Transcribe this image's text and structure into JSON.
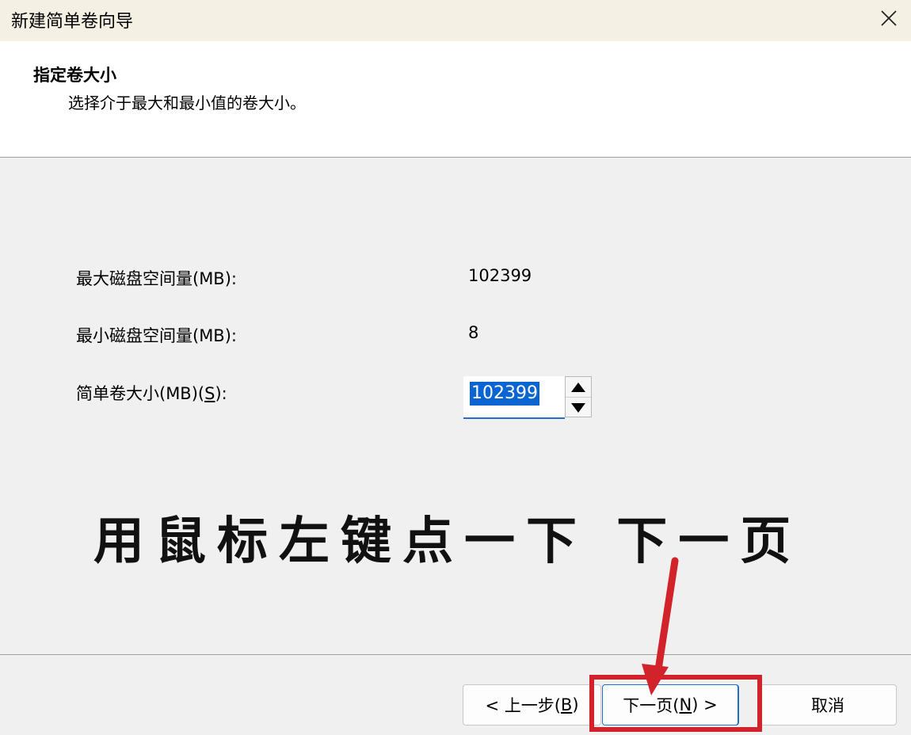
{
  "window": {
    "title": "新建简单卷向导",
    "close_glyph": "✕"
  },
  "header": {
    "title": "指定卷大小",
    "subtitle": "选择介于最大和最小值的卷大小。"
  },
  "fields": {
    "max_label": "最大磁盘空间量(MB):",
    "max_value": "102399",
    "min_label": "最小磁盘空间量(MB):",
    "min_value": "8",
    "size_label_prefix": "简单卷大小(MB)(",
    "size_label_key": "S",
    "size_label_suffix": "):",
    "size_value": "102399"
  },
  "annotation": {
    "text": "用鼠标左键点一下 下一页",
    "arrow_color": "#d2222a"
  },
  "buttons": {
    "back_prefix": "< 上一步(",
    "back_key": "B",
    "back_suffix": ")",
    "next_prefix": "下一页(",
    "next_key": "N",
    "next_suffix": ") >",
    "cancel": "取消"
  },
  "icons": {
    "close": "close-icon",
    "up": "spin-up-icon",
    "down": "spin-down-icon"
  }
}
